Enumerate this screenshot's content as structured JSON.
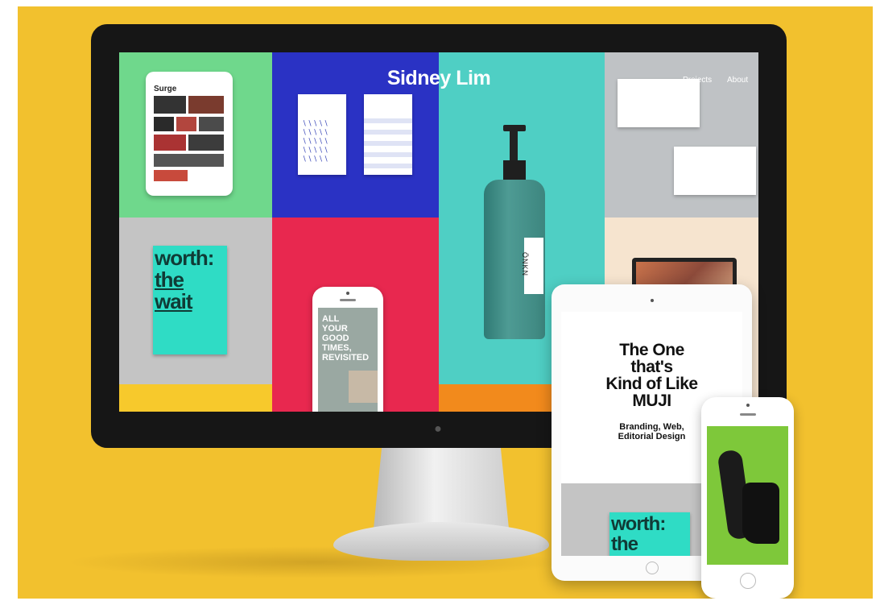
{
  "site": {
    "title": "Sidney Lim",
    "nav": [
      "Projects",
      "About"
    ]
  },
  "tiles": {
    "surge_title": "Surge",
    "poster_words": [
      "worth:",
      "the",
      "wait"
    ],
    "phone_words": [
      "ALL",
      "YOUR",
      "GOOD",
      "TIMES,",
      "REVISITED"
    ],
    "bottle_label": "ÖNKN"
  },
  "tablet": {
    "heading_lines": [
      "The One",
      "that's",
      "Kind of Like",
      "MUJI"
    ],
    "sub_lines": [
      "Branding, Web,",
      "Editorial Design"
    ],
    "poster_words": [
      "worth:",
      "the"
    ]
  },
  "colors": {
    "background": "#f2c12e",
    "green_tile": "#6fd88c",
    "blue_tile": "#2a32c4",
    "teal_tile": "#4fcfc4",
    "gray_tile": "#c4c4c4",
    "pink_tile": "#e8284f",
    "poster": "#2fdcc5",
    "shoe_screen": "#7ec83a"
  },
  "icons": [
    "apple-logo-icon"
  ]
}
